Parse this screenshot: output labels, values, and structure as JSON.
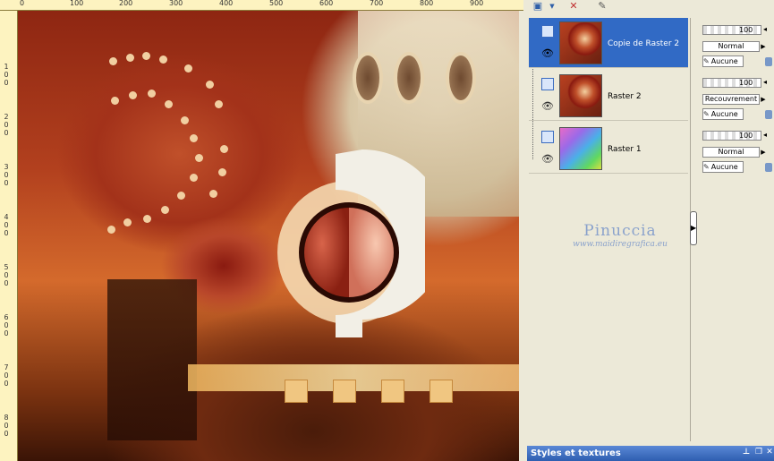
{
  "ruler_top": [
    "0",
    "100",
    "200",
    "300",
    "400",
    "500",
    "600",
    "700",
    "800",
    "900"
  ],
  "ruler_left": [
    "1 0 0",
    "2 0 0",
    "3 0 0",
    "4 0 0",
    "5 0 0",
    "6 0 0",
    "7 0 0",
    "8 0 0"
  ],
  "layers": [
    {
      "name": "Copie de Raster 2",
      "opacity": "100",
      "blend": "Normal",
      "mask": "Aucune"
    },
    {
      "name": "Raster 2",
      "opacity": "100",
      "blend": "Recouvrement",
      "mask": "Aucune"
    },
    {
      "name": "Raster 1",
      "opacity": "100",
      "blend": "Normal",
      "mask": "Aucune"
    }
  ],
  "watermark": {
    "name": "Pinuccia",
    "url": "www.maidiregrafica.eu"
  },
  "styles_panel": {
    "title": "Styles et textures"
  },
  "icons": {
    "layer": "layer-icon",
    "visibility": "eye-icon",
    "delete": "delete-layer-icon",
    "edit": "edit-icon",
    "mask": "brush-icon",
    "lock": "lock-icon"
  },
  "colors": {
    "selection": "#316ac5",
    "title_bar": "#2e5eb0"
  }
}
